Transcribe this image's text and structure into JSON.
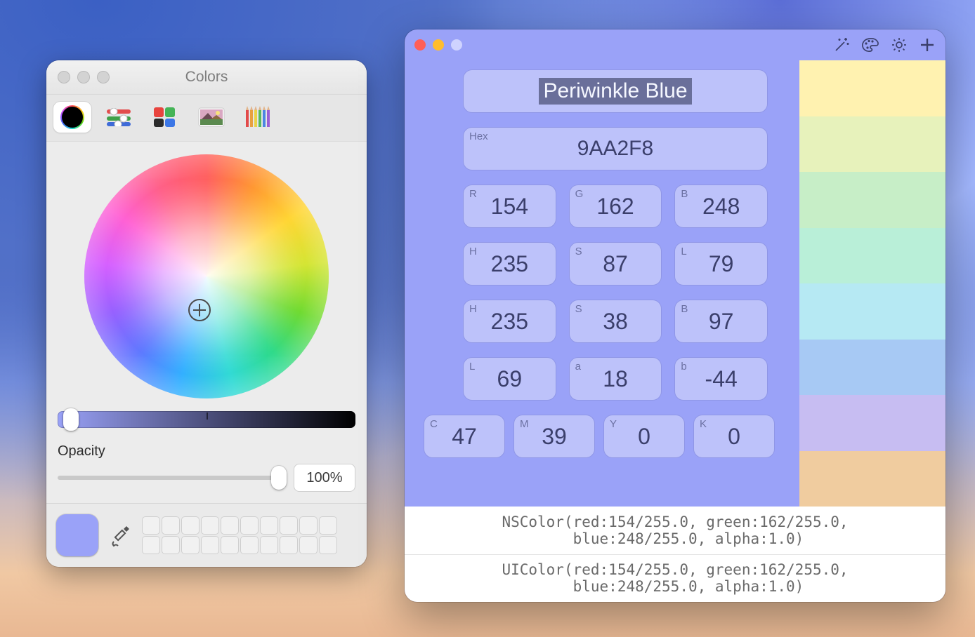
{
  "colorsWindow": {
    "title": "Colors",
    "opacity": {
      "label": "Opacity",
      "value": "100%"
    },
    "currentSwatch": "#9aa2f8"
  },
  "infoWindow": {
    "name": "Periwinkle Blue",
    "hexLabel": "Hex",
    "hex": "9AA2F8",
    "rgb": {
      "rL": "R",
      "r": "154",
      "gL": "G",
      "g": "162",
      "bL": "B",
      "b": "248"
    },
    "hsl": {
      "hL": "H",
      "h": "235",
      "sL": "S",
      "s": "87",
      "lL": "L",
      "l": "79"
    },
    "hsb": {
      "hL": "H",
      "h": "235",
      "sL": "S",
      "s": "38",
      "bL": "B",
      "b": "97"
    },
    "lab": {
      "lL": "L",
      "l": "69",
      "aL": "a",
      "a": "18",
      "bL": "b",
      "b": "-44"
    },
    "cmyk": {
      "cL": "C",
      "c": "47",
      "mL": "M",
      "m": "39",
      "yL": "Y",
      "y": "0",
      "kL": "K",
      "k": "0"
    },
    "palette": [
      "#fff2b0",
      "#e7f2bb",
      "#c7eec7",
      "#b9efd8",
      "#b6e9f3",
      "#a7c9f4",
      "#c7bdf2",
      "#f0cc9f"
    ],
    "code1": "NSColor(red:154/255.0, green:162/255.0,\n   blue:248/255.0, alpha:1.0)",
    "code2": "UIColor(red:154/255.0, green:162/255.0,\n   blue:248/255.0, alpha:1.0)"
  }
}
